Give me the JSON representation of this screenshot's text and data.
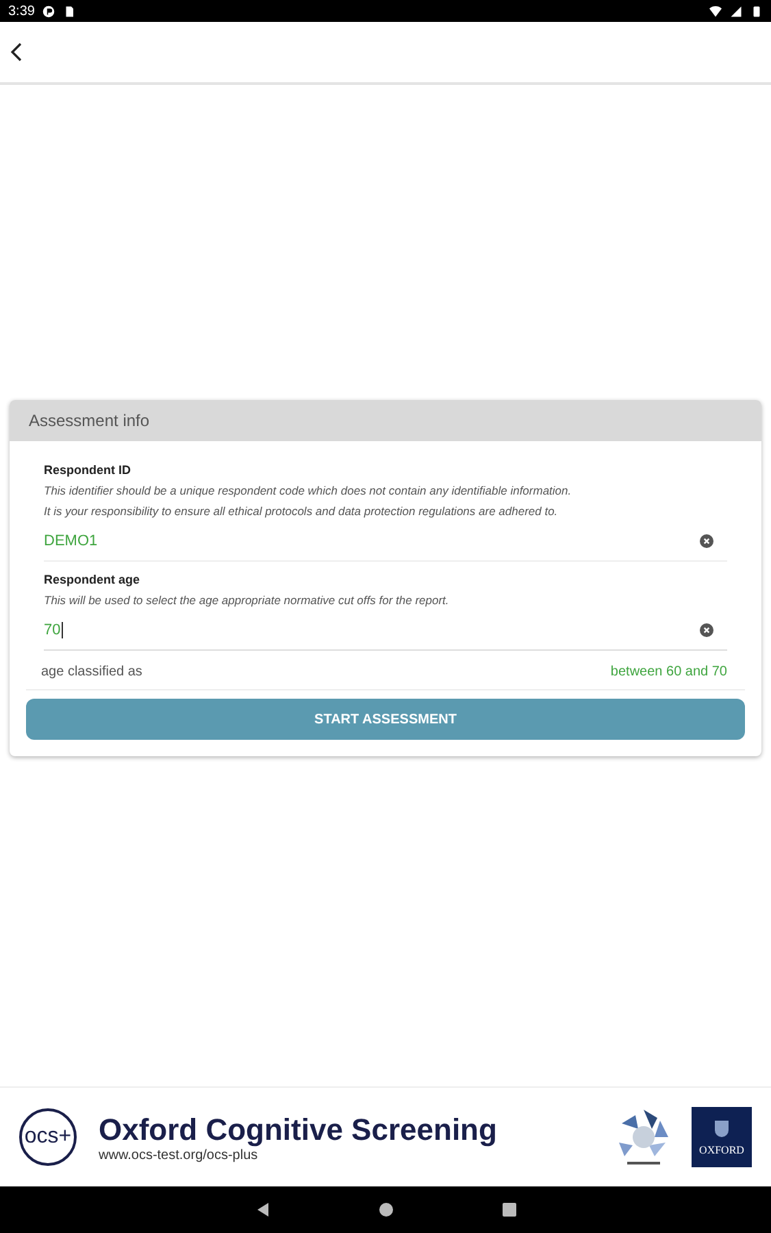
{
  "status_bar": {
    "time": "3:39"
  },
  "card": {
    "title": "Assessment info",
    "fields": [
      {
        "label": "Respondent ID",
        "hints": [
          "This identifier should be a unique respondent code which does not contain any identifiable information.",
          "It is your responsibility to ensure all ethical protocols and data protection regulations are adhered to."
        ],
        "value": "DEMO1",
        "focused": false
      },
      {
        "label": "Respondent age",
        "hints": [
          "This will be used to select the age appropriate normative cut offs for the report."
        ],
        "value": "70",
        "focused": true
      }
    ],
    "classification": {
      "label": "age classified as",
      "value": "between 60 and 70"
    },
    "button": "START ASSESSMENT"
  },
  "footer": {
    "logo_text": "ocs+",
    "title": "Oxford Cognitive Screening",
    "url": "www.ocs-test.org/ocs-plus",
    "badge_text": "OXFORD"
  }
}
